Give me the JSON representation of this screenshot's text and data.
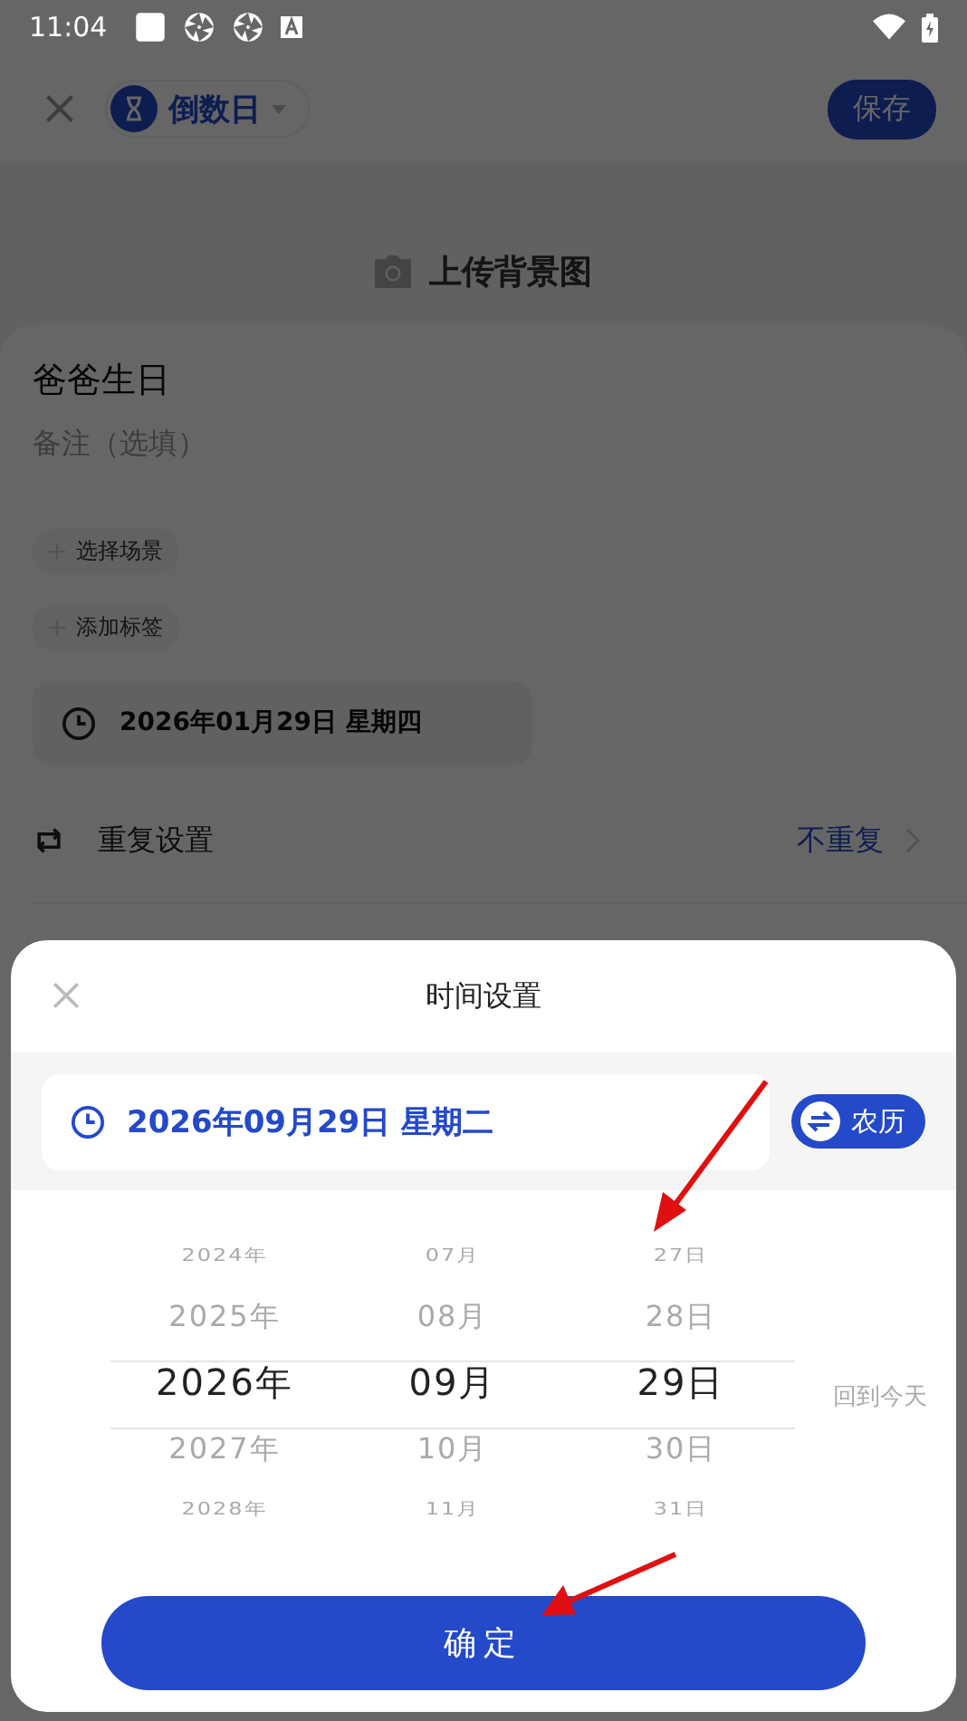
{
  "status_bar": {
    "time": "11:04"
  },
  "header": {
    "type_label": "倒数日",
    "save": "保存"
  },
  "upload": {
    "label": "上传背景图"
  },
  "event": {
    "title": "爸爸生日",
    "note_placeholder": "备注（选填）",
    "chips": [
      "选择场景",
      "添加标签"
    ],
    "date": "2026年01月29日 星期四",
    "repeat": {
      "label": "重复设置",
      "value": "不重复"
    }
  },
  "sheet": {
    "title": "时间设置",
    "selected_date": "2026年09月29日 星期二",
    "lunar": "农历",
    "columns": [
      {
        "items": [
          {
            "label": "2024年",
            "selected": false
          },
          {
            "label": "2025年",
            "selected": false
          },
          {
            "label": "2026年",
            "selected": true
          },
          {
            "label": "2027年",
            "selected": false
          },
          {
            "label": "2028年",
            "selected": false
          }
        ]
      },
      {
        "items": [
          {
            "label": "07月",
            "selected": false
          },
          {
            "label": "08月",
            "selected": false
          },
          {
            "label": "09月",
            "selected": true
          },
          {
            "label": "10月",
            "selected": false
          },
          {
            "label": "11月",
            "selected": false
          }
        ]
      },
      {
        "items": [
          {
            "label": "27日",
            "selected": false
          },
          {
            "label": "28日",
            "selected": false
          },
          {
            "label": "29日",
            "selected": true
          },
          {
            "label": "30日",
            "selected": false
          },
          {
            "label": "31日",
            "selected": false
          }
        ]
      }
    ],
    "today": "回到今天",
    "confirm": "确定"
  }
}
